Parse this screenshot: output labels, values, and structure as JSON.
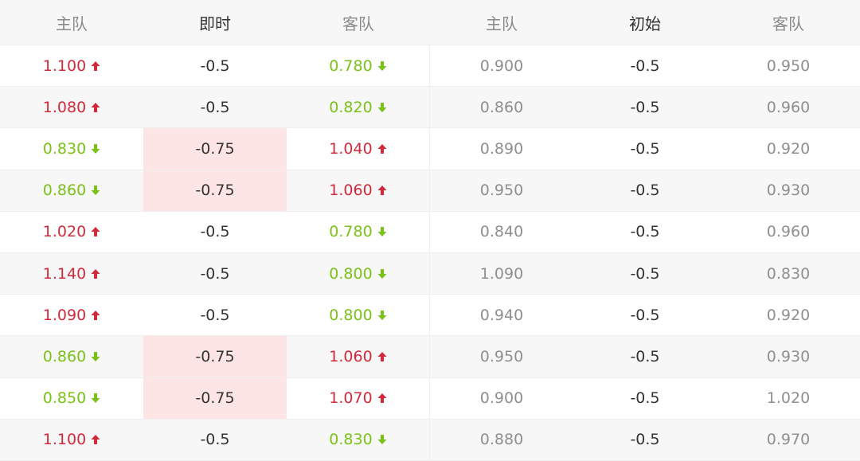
{
  "colors": {
    "up": "#d22a3a",
    "down": "#7bc218",
    "highlight": "#fde5e5"
  },
  "headers": {
    "live_home": "主队",
    "live_handicap": "即时",
    "live_away": "客队",
    "init_home": "主队",
    "init_handicap": "初始",
    "init_away": "客队"
  },
  "rows": [
    {
      "live_home": "1.100",
      "home_dir": "up",
      "live_handicap": "-0.5",
      "hl": false,
      "live_away": "0.780",
      "away_dir": "down",
      "init_home": "0.900",
      "init_handicap": "-0.5",
      "init_away": "0.950"
    },
    {
      "live_home": "1.080",
      "home_dir": "up",
      "live_handicap": "-0.5",
      "hl": false,
      "live_away": "0.820",
      "away_dir": "down",
      "init_home": "0.860",
      "init_handicap": "-0.5",
      "init_away": "0.960"
    },
    {
      "live_home": "0.830",
      "home_dir": "down",
      "live_handicap": "-0.75",
      "hl": true,
      "live_away": "1.040",
      "away_dir": "up",
      "init_home": "0.890",
      "init_handicap": "-0.5",
      "init_away": "0.920"
    },
    {
      "live_home": "0.860",
      "home_dir": "down",
      "live_handicap": "-0.75",
      "hl": true,
      "live_away": "1.060",
      "away_dir": "up",
      "init_home": "0.950",
      "init_handicap": "-0.5",
      "init_away": "0.930"
    },
    {
      "live_home": "1.020",
      "home_dir": "up",
      "live_handicap": "-0.5",
      "hl": false,
      "live_away": "0.780",
      "away_dir": "down",
      "init_home": "0.840",
      "init_handicap": "-0.5",
      "init_away": "0.960"
    },
    {
      "live_home": "1.140",
      "home_dir": "up",
      "live_handicap": "-0.5",
      "hl": false,
      "live_away": "0.800",
      "away_dir": "down",
      "init_home": "1.090",
      "init_handicap": "-0.5",
      "init_away": "0.830"
    },
    {
      "live_home": "1.090",
      "home_dir": "up",
      "live_handicap": "-0.5",
      "hl": false,
      "live_away": "0.800",
      "away_dir": "down",
      "init_home": "0.940",
      "init_handicap": "-0.5",
      "init_away": "0.920"
    },
    {
      "live_home": "0.860",
      "home_dir": "down",
      "live_handicap": "-0.75",
      "hl": true,
      "live_away": "1.060",
      "away_dir": "up",
      "init_home": "0.950",
      "init_handicap": "-0.5",
      "init_away": "0.930"
    },
    {
      "live_home": "0.850",
      "home_dir": "down",
      "live_handicap": "-0.75",
      "hl": true,
      "live_away": "1.070",
      "away_dir": "up",
      "init_home": "0.900",
      "init_handicap": "-0.5",
      "init_away": "1.020"
    },
    {
      "live_home": "1.100",
      "home_dir": "up",
      "live_handicap": "-0.5",
      "hl": false,
      "live_away": "0.830",
      "away_dir": "down",
      "init_home": "0.880",
      "init_handicap": "-0.5",
      "init_away": "0.970"
    }
  ]
}
